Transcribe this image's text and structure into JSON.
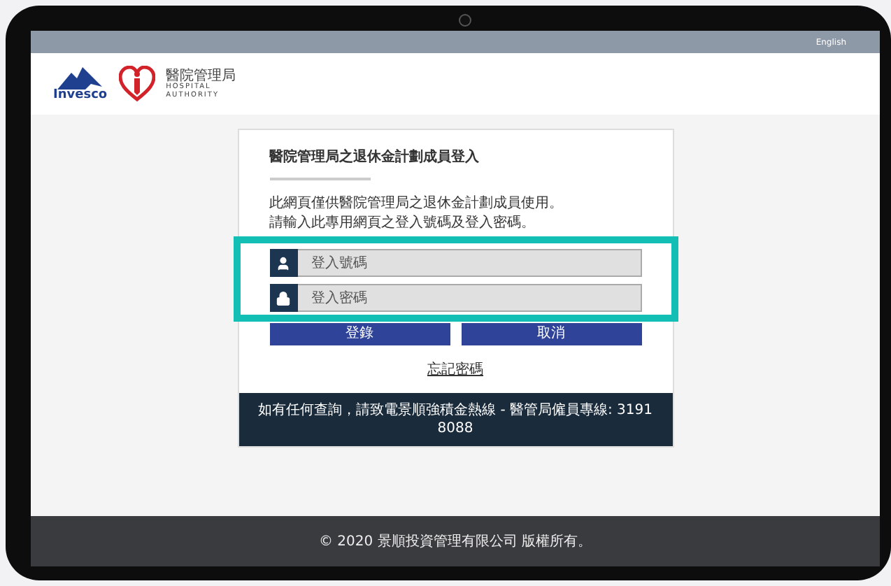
{
  "top_bar": {
    "language_link": "English"
  },
  "header": {
    "brand": "Invesco",
    "partner": {
      "name_zh": "醫院管理局",
      "name_en_1": "HOSPITAL",
      "name_en_2": "AUTHORITY"
    }
  },
  "login_card": {
    "title": "醫院管理局之退休金計劃成員登入",
    "description": [
      "此網頁僅供醫院管理局之退休金計劃成員使用。",
      "請輸入此專用網頁之登入號碼及登入密碼。"
    ],
    "fields": [
      {
        "kind": "user",
        "placeholder": "登入號碼"
      },
      {
        "kind": "password",
        "placeholder": "登入密碼"
      }
    ],
    "buttons": [
      "登錄",
      "取消"
    ],
    "forgot_link": "忘記密碼",
    "contact_strip": "如有任何查詢，請致電景順強積金熱線 - 醫管局僱員專線: 3191 8088"
  },
  "footer": {
    "copyright": "© 2020 景順投資管理有限公司 版權所有。"
  }
}
